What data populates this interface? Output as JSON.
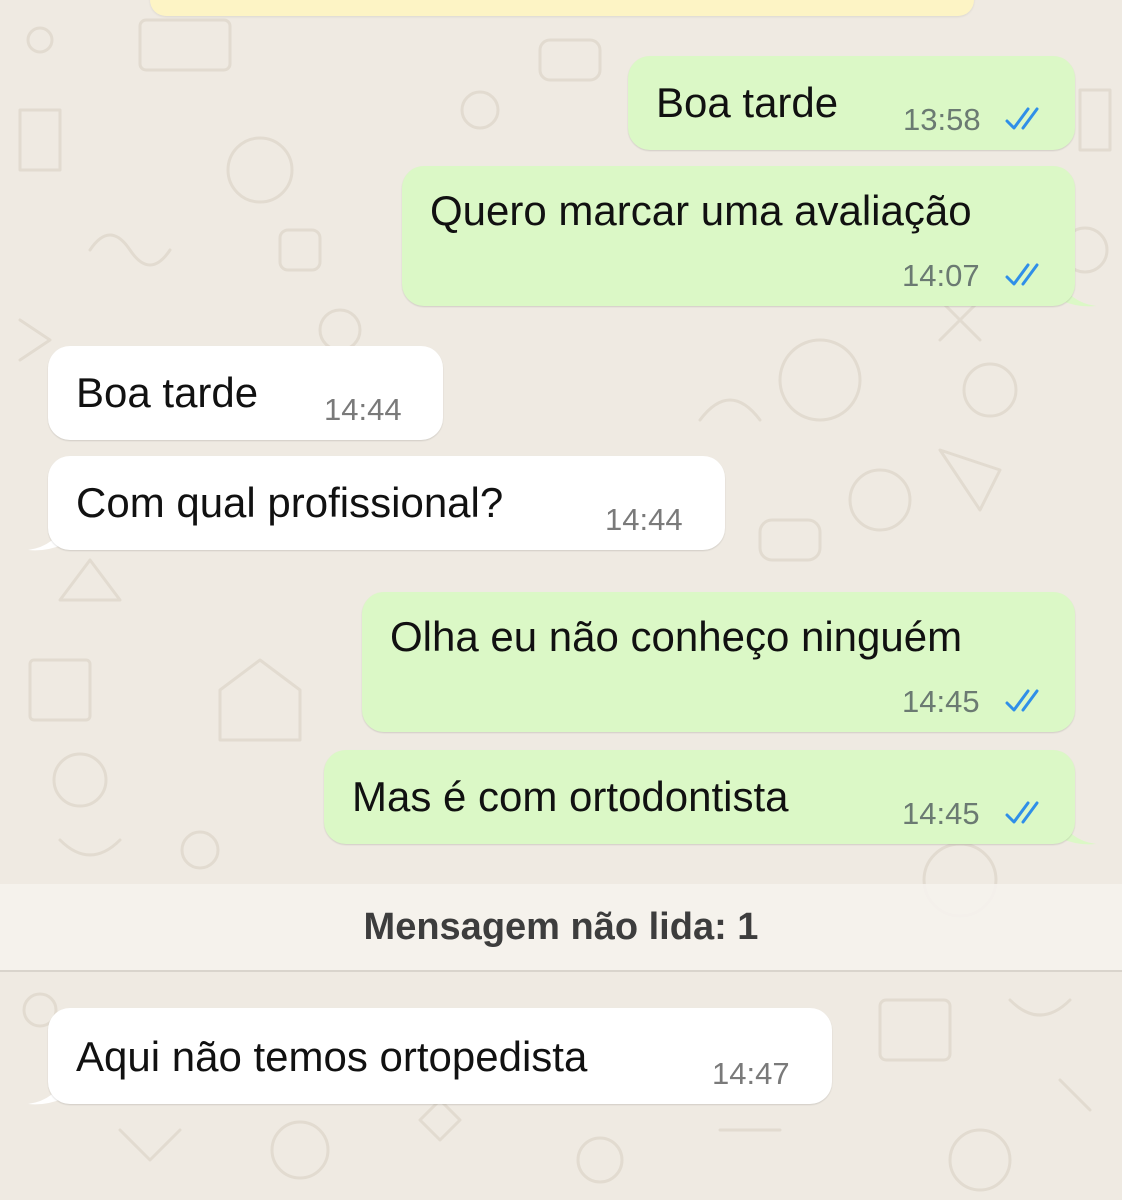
{
  "chat": {
    "messages": [
      {
        "direction": "outgoing",
        "text": "Boa tarde",
        "time": "13:58",
        "status": "read"
      },
      {
        "direction": "outgoing",
        "text": "Quero marcar uma avaliação",
        "time": "14:07",
        "status": "read"
      },
      {
        "direction": "incoming",
        "text": "Boa tarde",
        "time": "14:44"
      },
      {
        "direction": "incoming",
        "text": "Com qual profissional?",
        "time": "14:44"
      },
      {
        "direction": "outgoing",
        "text": "Olha eu não conheço ninguém",
        "time": "14:45",
        "status": "read"
      },
      {
        "direction": "outgoing",
        "text": "Mas é com ortodontista",
        "time": "14:45",
        "status": "read"
      },
      {
        "direction": "incoming",
        "text": "Aqui não temos ortopedista",
        "time": "14:47"
      }
    ],
    "unread_divider": "Mensagem não lida: 1"
  },
  "colors": {
    "wallpaper": "#efeae2",
    "outgoing_bubble": "#dbf8c6",
    "incoming_bubble": "#ffffff",
    "read_tick": "#2f8fe8",
    "banner": "#fdf4c5"
  },
  "icons": {
    "read_status": "double-check-icon"
  }
}
